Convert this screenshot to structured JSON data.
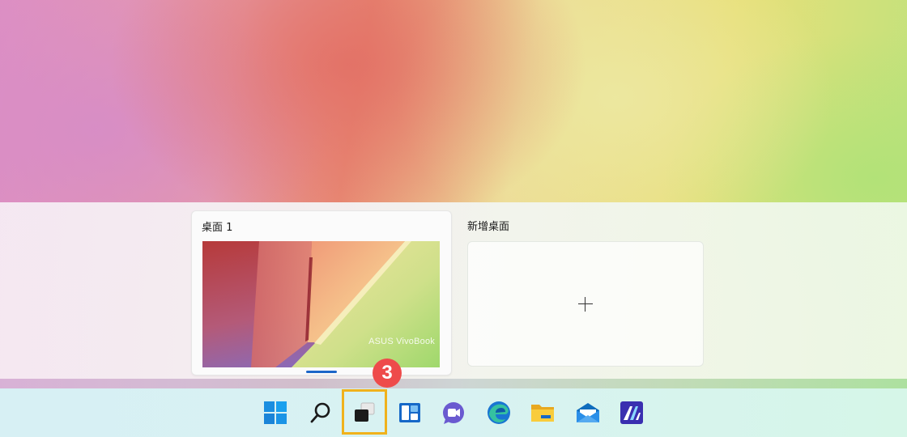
{
  "task_view": {
    "desktops": [
      {
        "label": "桌面 1",
        "thumbnail_brand": "ASUS VivoBook",
        "active": true
      }
    ],
    "new_desktop_label": "新增桌面",
    "new_desktop_icon": "plus-icon"
  },
  "taskbar": {
    "icons": [
      {
        "name": "start-icon"
      },
      {
        "name": "search-icon"
      },
      {
        "name": "task-view-icon"
      },
      {
        "name": "widgets-icon"
      },
      {
        "name": "teams-chat-icon"
      },
      {
        "name": "edge-icon"
      },
      {
        "name": "file-explorer-icon"
      },
      {
        "name": "mail-icon"
      },
      {
        "name": "myasus-icon"
      }
    ]
  },
  "annotation": {
    "step_number": "3",
    "highlight_color": "#f0b21c",
    "badge_color": "#ee4b4b"
  }
}
